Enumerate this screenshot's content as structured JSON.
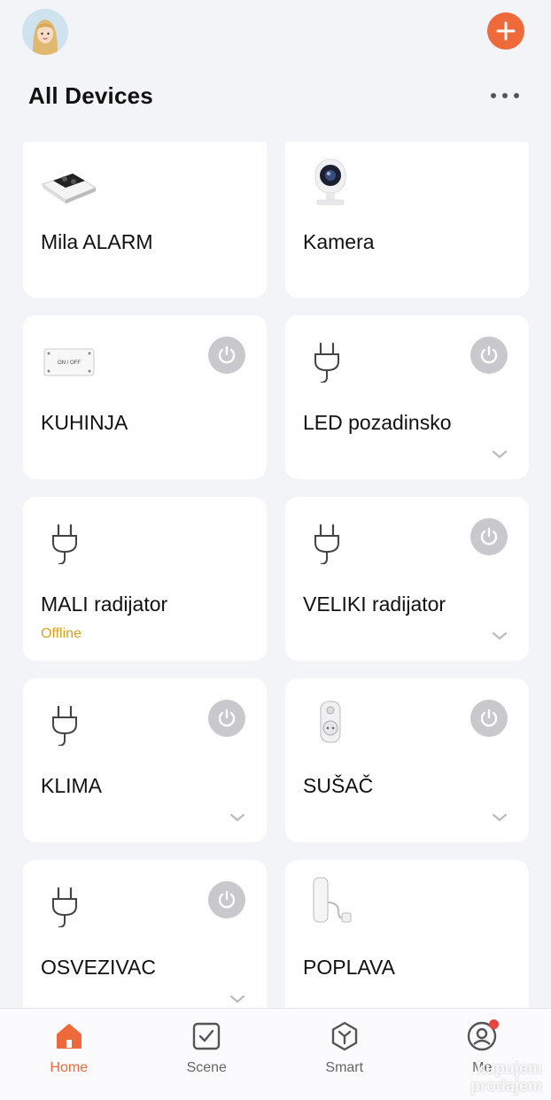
{
  "header": {
    "title": "All Devices"
  },
  "icons": {
    "avatar": "user-avatar",
    "add": "plus-icon",
    "more": "more-horizontal-icon",
    "power": "power-icon",
    "chevron": "chevron-down-icon"
  },
  "colors": {
    "accent": "#ef6a3a",
    "offline": "#d9a21a",
    "power_button": "#c9c9cd",
    "background": "#f3f4f8"
  },
  "devices": [
    {
      "name": "Mila ALARM",
      "status": "",
      "image": "alarm-hub-icon",
      "power": false,
      "chevron": false
    },
    {
      "name": "Kamera",
      "status": "",
      "image": "camera-icon",
      "power": false,
      "chevron": false
    },
    {
      "name": "KUHINJA",
      "status": "",
      "image": "switch-icon",
      "power": true,
      "chevron": false
    },
    {
      "name": "LED pozadinsko",
      "status": "",
      "image": "plug-icon",
      "power": true,
      "chevron": true
    },
    {
      "name": "MALI radijator",
      "status": "Offline",
      "image": "plug-icon",
      "power": false,
      "chevron": false
    },
    {
      "name": "VELIKI radijator",
      "status": "",
      "image": "plug-icon",
      "power": true,
      "chevron": true
    },
    {
      "name": "KLIMA",
      "status": "",
      "image": "plug-icon",
      "power": true,
      "chevron": true
    },
    {
      "name": "SUŠAČ",
      "status": "",
      "image": "smart-socket-icon",
      "power": true,
      "chevron": true
    },
    {
      "name": "OSVEZIVAC",
      "status": "",
      "image": "plug-icon",
      "power": true,
      "chevron": true
    },
    {
      "name": "POPLAVA",
      "status": "",
      "image": "water-sensor-icon",
      "power": false,
      "chevron": false
    }
  ],
  "tabs": [
    {
      "label": "Home",
      "icon": "home-icon",
      "active": true
    },
    {
      "label": "Scene",
      "icon": "checkbox-icon",
      "active": false
    },
    {
      "label": "Smart",
      "icon": "smart-cube-icon",
      "active": false
    },
    {
      "label": "Me",
      "icon": "profile-icon",
      "active": false
    }
  ],
  "watermark": {
    "line1": "kupujem",
    "line2": "prodajem"
  }
}
